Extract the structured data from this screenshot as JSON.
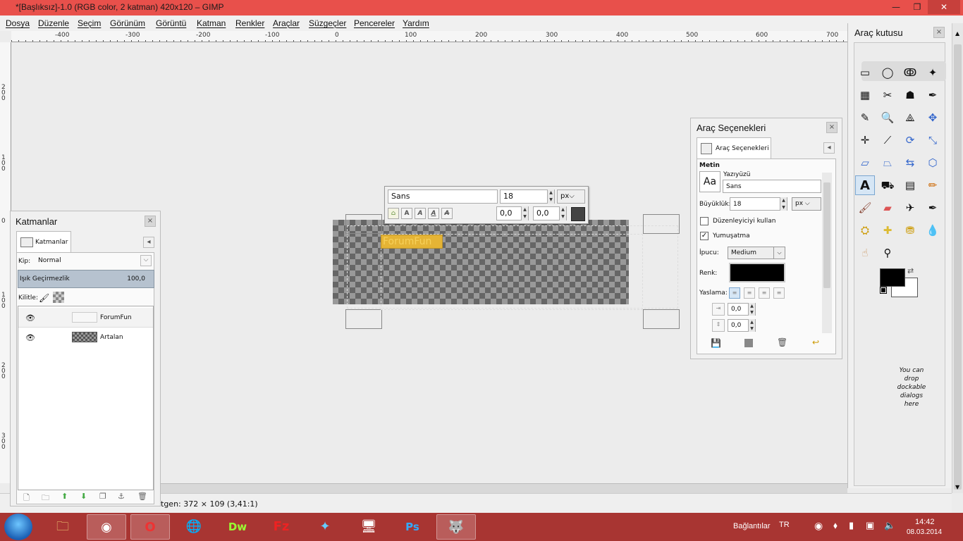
{
  "window": {
    "title": "*[Başlıksız]-1.0 (RGB color, 2 katman) 420x120 – GIMP",
    "min_label": "—",
    "max_label": "❐",
    "close_label": "✕"
  },
  "menu": [
    "Dosya",
    "Düzenle",
    "Seçim",
    "Görünüm",
    "Görüntü",
    "Katman",
    "Renkler",
    "Araçlar",
    "Süzgeçler",
    "Pencereler",
    "Yardım"
  ],
  "rulers": {
    "h_labels": [
      "-400",
      "-300",
      "-200",
      "-100",
      "0",
      "100",
      "200",
      "300",
      "400",
      "500",
      "600",
      "700"
    ],
    "v_labels": [
      "200",
      "100",
      "0",
      "100",
      "200",
      "300"
    ]
  },
  "canvas": {
    "text_layer_text": "ForumFun"
  },
  "on_canvas_text_box": {
    "font": "Sans",
    "size": "18",
    "unit": "px",
    "unit_arrow": "⌵",
    "baseline": "0,0",
    "kerning": "0,0"
  },
  "status": {
    "text": "tgen: 372 × 109  (3,41:1)"
  },
  "layers_dock": {
    "title": "Katmanlar",
    "tab_label": "Katmanlar",
    "mode_label": "Kip:",
    "mode_value": "Normal",
    "opacity_label": "Işık Geçirmezlik",
    "opacity_value": "100,0",
    "lock_label": "Kilitle:",
    "layers": [
      {
        "name": "ForumFun",
        "visible": true
      },
      {
        "name": "Artalan",
        "visible": true
      }
    ]
  },
  "tool_options": {
    "title": "Araç Seçenekleri",
    "tab_label": "Araç Seçenekleri",
    "section": "Metin",
    "font_label": "Yazıyüzü",
    "font_preview": "Aa",
    "font_value": "Sans",
    "size_label": "Büyüklük:",
    "size_value": "18",
    "size_unit": "px",
    "use_editor_label": "Düzenleyiciyi kullan",
    "use_editor_checked": false,
    "antialias_label": "Yumuşatma",
    "antialias_checked": true,
    "hint_label": "İpucu:",
    "hint_value": "Medium",
    "color_label": "Renk:",
    "color_value": "#000000",
    "justify_label": "Yaslama:",
    "indent_value": "0,0",
    "line_spacing_value": "0,0"
  },
  "toolbox": {
    "title": "Araç kutusu",
    "fg_color": "#000000",
    "bg_color": "#ffffff",
    "drop_hint": "You can drop dockable dialogs here"
  },
  "taskbar": {
    "tray_label": "Bağlantılar",
    "lang": "TR",
    "time": "14:42",
    "date": "08.03.2014"
  }
}
